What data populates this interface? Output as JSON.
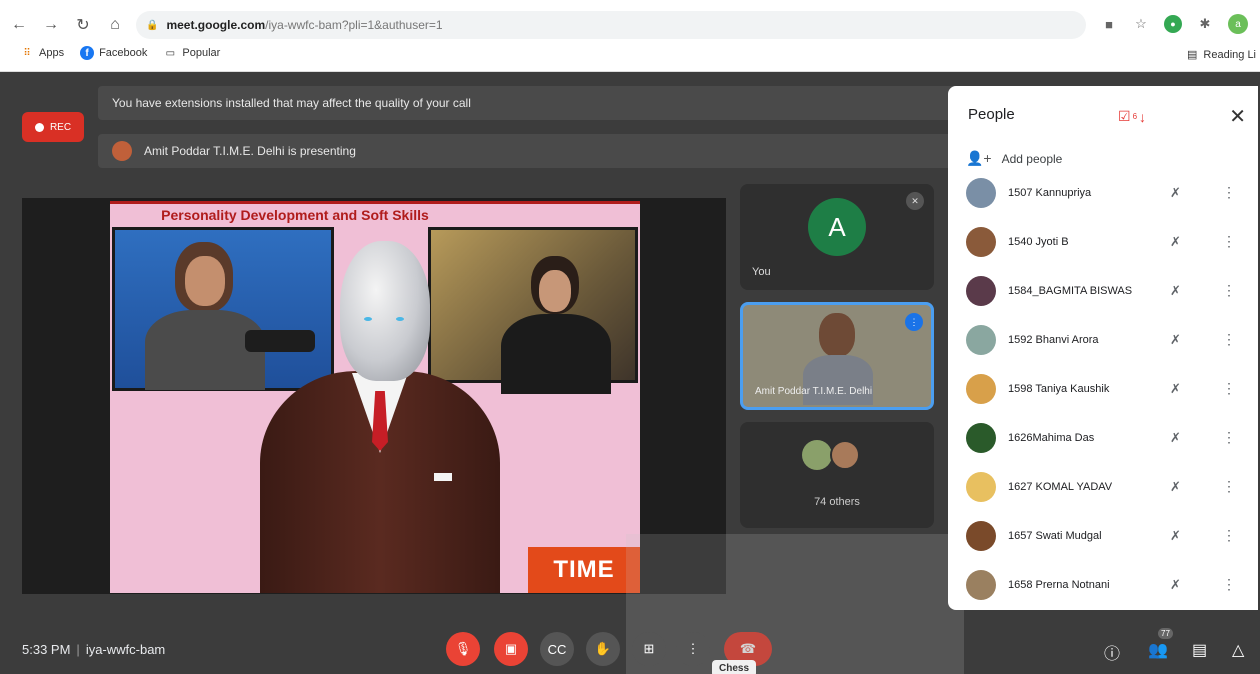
{
  "browser": {
    "url_host": "meet.google.com",
    "url_path": "/iya-wwfc-bam?pli=1&authuser=1",
    "bookmarks": [
      "Apps",
      "Facebook",
      "Popular"
    ],
    "reading_list": "Reading Li"
  },
  "meet": {
    "rec_label": "REC",
    "banner_extensions": "You have extensions installed that may affect the quality of your call",
    "banner_presenting": "Amit Poddar T.I.M.E. Delhi is presenting",
    "slide": {
      "title": "Personality Development and Soft Skills",
      "logo": "TIME"
    },
    "tiles": {
      "you_initial": "A",
      "you_label": "You",
      "speaker_label": "Amit Poddar T.I.M.E. Delhi",
      "others_label": "74 others"
    }
  },
  "people_panel": {
    "title": "People",
    "annotation_count": "6",
    "add_people": "Add people",
    "participants": [
      {
        "name": "1507 Kannupriya",
        "color": "#7a8fa6"
      },
      {
        "name": "1540 Jyoti B",
        "color": "#8a5a3a"
      },
      {
        "name": "1584_BAGMITA BISWAS",
        "color": "#5a3a4a"
      },
      {
        "name": "1592 Bhanvi Arora",
        "color": "#8aa7a0"
      },
      {
        "name": "1598 Taniya Kaushik",
        "color": "#d8a04a"
      },
      {
        "name": "1626Mahima Das",
        "color": "#2a5a2a"
      },
      {
        "name": "1627 KOMAL YADAV",
        "color": "#e8c060"
      },
      {
        "name": "1657 Swati Mudgal",
        "color": "#7a4a2a"
      },
      {
        "name": "1658 Prerna Notnani",
        "color": "#9a8060"
      }
    ]
  },
  "bottom_bar": {
    "time": "5:33 PM",
    "meeting_code": "iya-wwfc-bam",
    "chess_tooltip": "Chess",
    "people_count": "77"
  }
}
